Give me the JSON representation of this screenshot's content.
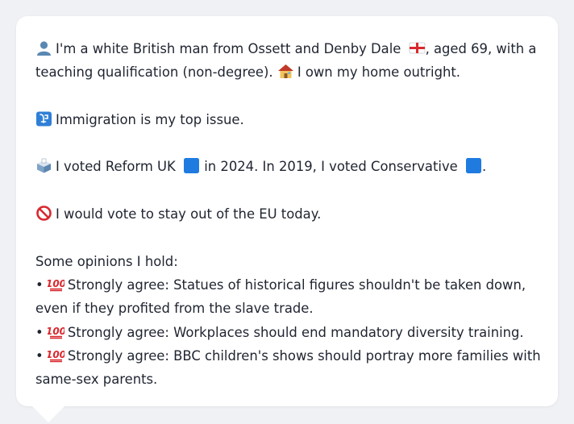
{
  "profile": {
    "line1": {
      "text_a": "I'm a white British man from Ossett and Denby Dale",
      "text_b": ", aged 69, with a"
    },
    "line2": {
      "text_a": "teaching qualification (non-degree).",
      "text_b": "I own my home outright."
    }
  },
  "issue": {
    "text": "Immigration is my top issue."
  },
  "vote": {
    "text_a": "I voted Reform UK",
    "text_b": "in 2024. In 2019, I voted Conservative",
    "text_c": "."
  },
  "eu": {
    "text": "I would vote to stay out of the EU today."
  },
  "opinions": {
    "header": "Some opinions I hold:",
    "bullet": "•",
    "items": [
      {
        "prefix": "Strongly agree:",
        "line1": "Statues of historical figures shouldn't be taken down,",
        "line2": "even if they profited from the slave trade."
      },
      {
        "prefix": "Strongly agree:",
        "line1": "Workplaces should end mandatory diversity training."
      },
      {
        "prefix": "Strongly agree:",
        "line1": "BBC children's shows should portray more families with",
        "line2": "same-sex parents."
      }
    ]
  },
  "icons": {
    "person": "bust-silhouette-icon",
    "flag": "england-flag-icon",
    "house": "house-icon",
    "issue": "immigration-passport-icon",
    "ballot": "ballot-box-icon",
    "reform_color": "#1f7be0",
    "conservative_color": "#1f7be0",
    "eu": "prohibited-icon",
    "hundred": "hundred-points-icon"
  },
  "colors": {
    "background": "#f0f1f4",
    "bubble": "#ffffff",
    "text": "#1f2430",
    "emoji_red": "#d8282f",
    "square_blue": "#1f7be0"
  }
}
